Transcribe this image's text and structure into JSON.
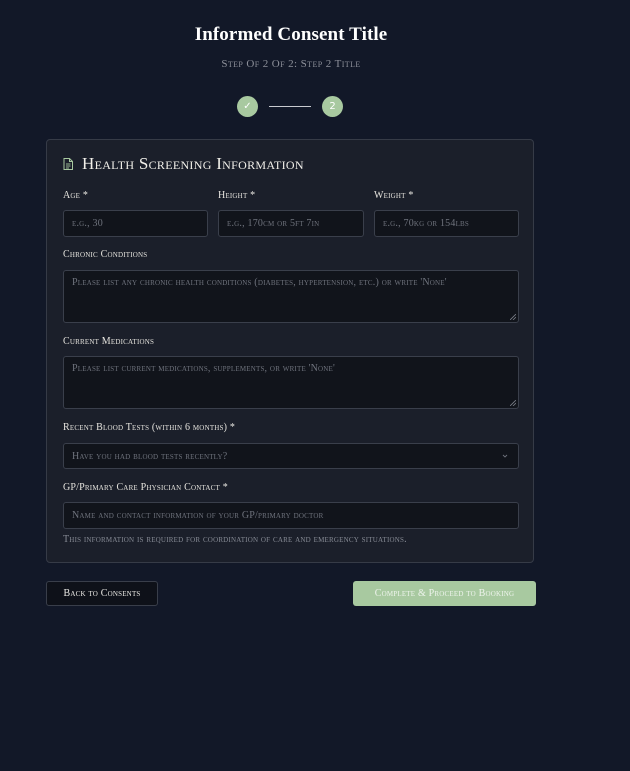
{
  "header": {
    "title": "Informed Consent Title",
    "subtitle": "Step Of 2 Of 2: Step 2 Title"
  },
  "stepper": {
    "step1_icon": "check-icon",
    "step1_glyph": "✓",
    "step2_label": "2",
    "completed_color": "#a8c9a0"
  },
  "form": {
    "heading": "Health Screening Information",
    "heading_icon": "document-icon",
    "age": {
      "label": "Age *",
      "placeholder": "e.g., 30"
    },
    "height": {
      "label": "Height *",
      "placeholder": "e.g., 170cm or 5ft 7in"
    },
    "weight": {
      "label": "Weight *",
      "placeholder": "e.g., 70kg or 154lbs"
    },
    "chronic_conditions": {
      "label": "Chronic Conditions",
      "placeholder": "Please list any chronic health conditions (diabetes, hypertension, etc.) or write 'None'"
    },
    "current_medications": {
      "label": "Current Medications",
      "placeholder": "Please list current medications, supplements, or write 'None'"
    },
    "blood_tests": {
      "label": "Recent Blood Tests (within 6 months) *",
      "selected": "Have you had blood tests recently?",
      "chevron_icon": "chevron-down-icon"
    },
    "gp_contact": {
      "label": "GP/Primary Care Physician Contact *",
      "placeholder": "Name and contact information of your GP/primary doctor",
      "help": "This information is required for coordination of care and emergency situations."
    }
  },
  "actions": {
    "back_label": "Back to Consents",
    "complete_label": "Complete & Proceed to Booking"
  },
  "colors": {
    "background": "#121828",
    "card": "#1b1f2a",
    "accent": "#a8c9a0"
  }
}
